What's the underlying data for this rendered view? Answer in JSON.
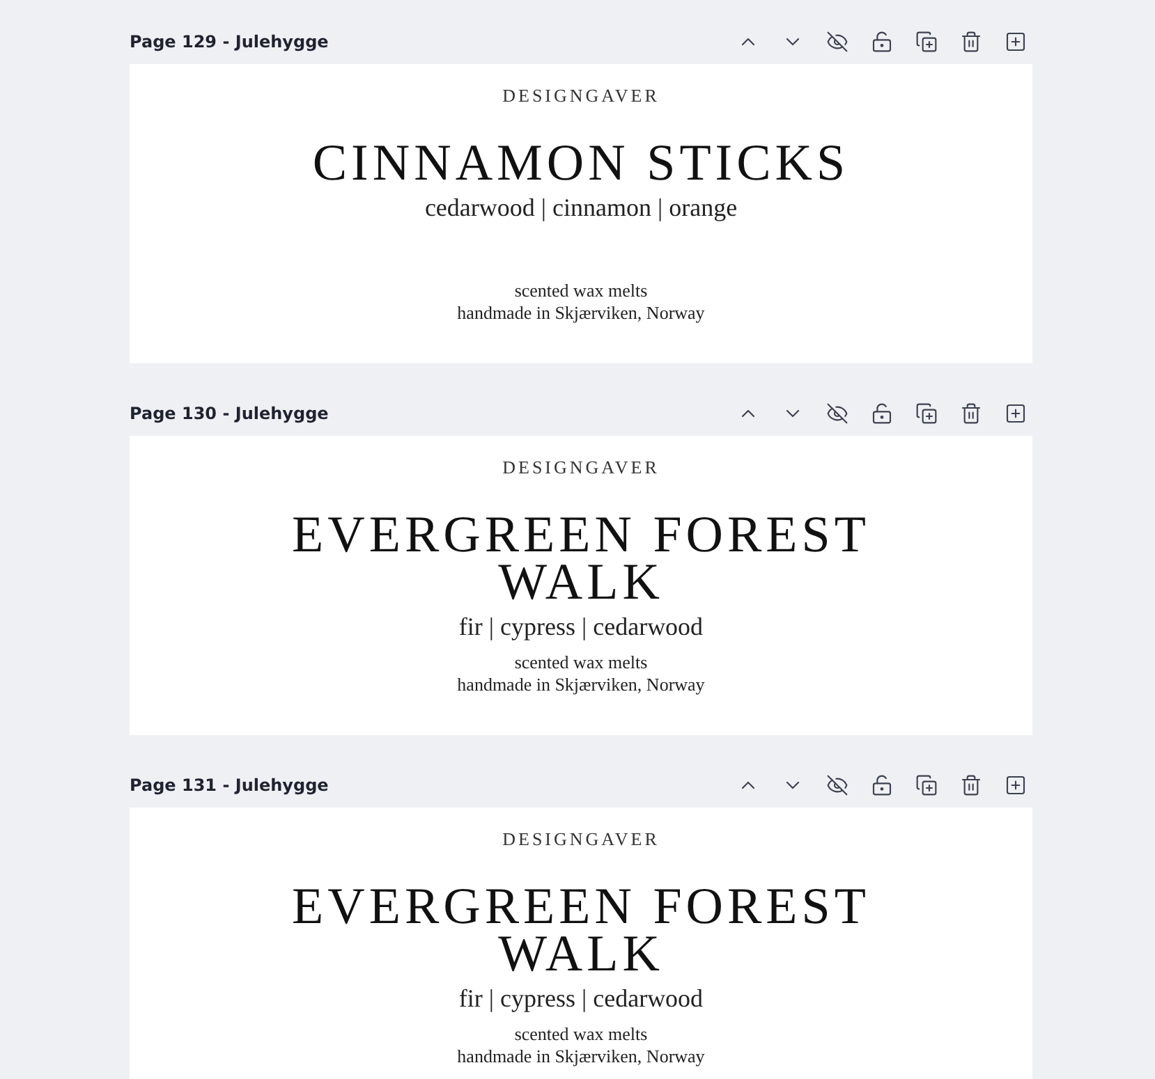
{
  "pages": [
    {
      "header": "Page 129 - Julehygge",
      "brand": "DESIGNGAVER",
      "title": "CINNAMON STICKS",
      "notes": "cedarwood | cinnamon | orange",
      "lines": [
        "scented wax melts",
        "handmade in Skjærviken, Norway"
      ]
    },
    {
      "header": "Page 130 - Julehygge",
      "brand": "DESIGNGAVER",
      "title": "EVERGREEN FOREST WALK",
      "notes": "fir | cypress | cedarwood",
      "lines": [
        "scented wax melts",
        "handmade in Skjærviken, Norway"
      ]
    },
    {
      "header": "Page 131 - Julehygge",
      "brand": "DESIGNGAVER",
      "title": "EVERGREEN FOREST WALK",
      "notes": "fir | cypress | cedarwood",
      "lines": [
        "scented wax melts",
        "handmade in Skjærviken, Norway"
      ]
    }
  ],
  "tools": [
    {
      "kind": "up"
    },
    {
      "kind": "down"
    },
    {
      "kind": "hide"
    },
    {
      "kind": "lock"
    },
    {
      "kind": "duplicate"
    },
    {
      "kind": "delete"
    },
    {
      "kind": "add"
    }
  ]
}
